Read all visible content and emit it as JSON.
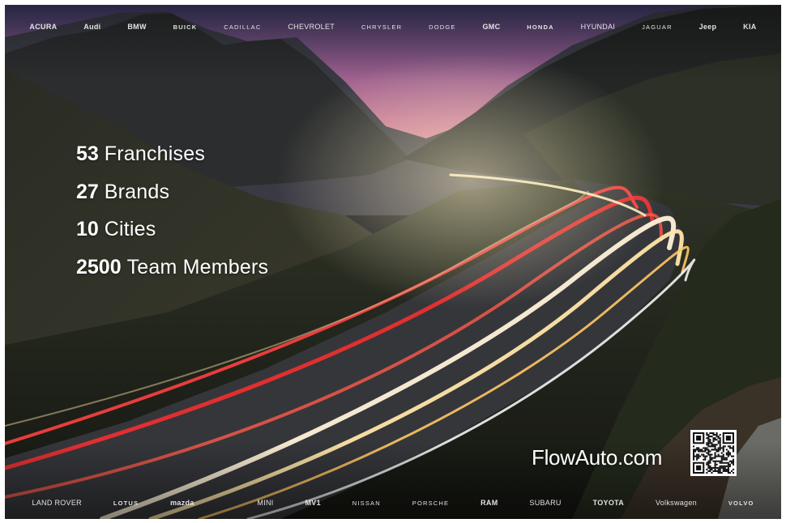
{
  "colors": {
    "sky_pink": "#c9708f",
    "sky_purple": "#6b4f86",
    "trail_red": "#ff3b3b",
    "trail_white": "#fff4dc",
    "trail_amber": "#ffb347"
  },
  "brands_top": [
    "ACURA",
    "Audi",
    "BMW",
    "BUICK",
    "CADILLAC",
    "CHEVROLET",
    "CHRYSLER",
    "DODGE",
    "GMC",
    "HONDA",
    "HYUNDAI",
    "JAGUAR",
    "Jeep",
    "KIA"
  ],
  "brands_bottom": [
    "LAND ROVER",
    "LOTUS",
    "mazda",
    "",
    "MINI",
    "MV1",
    "NISSAN",
    "PORSCHE",
    "RAM",
    "SUBARU",
    "TOYOTA",
    "Volkswagen",
    "VOLVO"
  ],
  "stats": [
    {
      "number": "53",
      "label": "Franchises"
    },
    {
      "number": "27",
      "label": "Brands"
    },
    {
      "number": "10",
      "label": "Cities"
    },
    {
      "number": "2500",
      "label": "Team Members"
    }
  ],
  "website": "FlowAuto.com",
  "qr_icon": "qr-code-icon"
}
